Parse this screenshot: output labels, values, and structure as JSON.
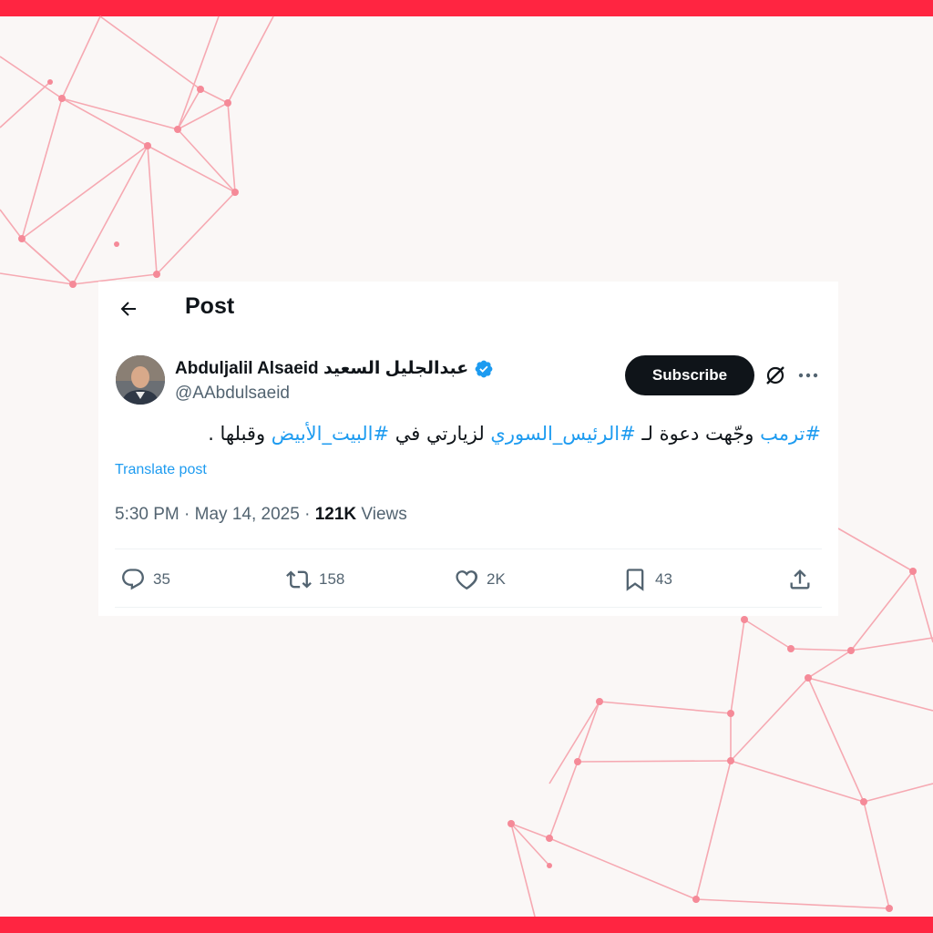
{
  "header": {
    "title": "Post"
  },
  "author": {
    "display_name": "Abduljalil Alsaeid عبدالجليل السعيد",
    "handle": "@AAbdulsaeid",
    "verified": true
  },
  "subscribe_label": "Subscribe",
  "tweet": {
    "tag_trump": "#ترمب",
    "text_1": " وجّهت دعوة لـ ",
    "tag_president": "#الرئيس_السوري",
    "text_2": " لزيارتي في ",
    "tag_whitehouse": "#البيت_الأبيض",
    "text_3": " وقبلها ."
  },
  "translate_label": "Translate post",
  "meta": {
    "time": "5:30 PM",
    "sep": " · ",
    "date": "May 14, 2025",
    "views_count": "121K",
    "views_label": " Views"
  },
  "actions": {
    "replies": "35",
    "reposts": "158",
    "likes": "2K",
    "bookmarks": "43"
  },
  "colors": {
    "accent_band": "#ff2541",
    "link_blue": "#1d9bf0",
    "text_primary": "#0f1419",
    "text_secondary": "#536471",
    "network_lines": "#f4a3ad"
  },
  "icons": [
    "back-arrow-icon",
    "verified-badge-icon",
    "grok-icon",
    "more-icon",
    "reply-icon",
    "repost-icon",
    "like-icon",
    "bookmark-icon",
    "share-icon"
  ]
}
